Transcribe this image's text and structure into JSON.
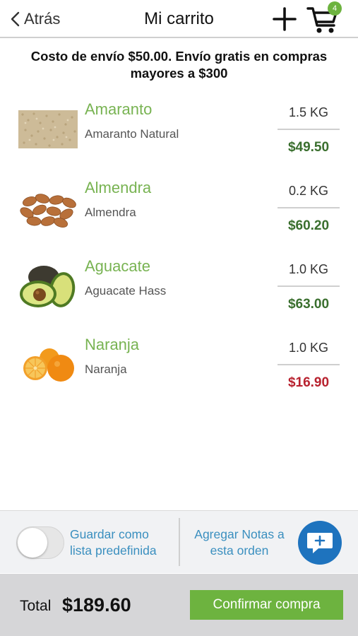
{
  "header": {
    "back_label": "Atrás",
    "title": "Mi carrito",
    "cart_count": "4"
  },
  "shipping_notice": {
    "line1": "Costo de envío $50.00. Envío gratis en compras",
    "line2": "mayores a $300"
  },
  "items": [
    {
      "name": "Amaranto",
      "description": "Amaranto Natural",
      "quantity": "1.5 KG",
      "price": "$49.50",
      "image": "amaranth-grain"
    },
    {
      "name": "Almendra",
      "description": "Almendra",
      "quantity": "0.2 KG",
      "price": "$60.20",
      "image": "almonds"
    },
    {
      "name": "Aguacate",
      "description": "Aguacate Hass",
      "quantity": "1.0 KG",
      "price": "$63.00",
      "image": "avocado"
    },
    {
      "name": "Naranja",
      "description": "Naranja",
      "quantity": "1.0 KG",
      "price": "$16.90",
      "image": "orange"
    }
  ],
  "options": {
    "save_line1": "Guardar como",
    "save_line2": "lista predefinida",
    "save_toggle_on": false,
    "notes_line1": "Agregar Notas a",
    "notes_line2": "esta orden"
  },
  "footer": {
    "total_label": "Total",
    "total_value": "$189.60",
    "confirm_label": "Confirmar compra"
  },
  "colors": {
    "accent_green": "#6db33f",
    "product_name_green": "#78b352",
    "price_green": "#3a6f2e",
    "price_red": "#b8222f",
    "link_blue": "#3a8fbf",
    "notes_button_blue": "#1e73be"
  }
}
